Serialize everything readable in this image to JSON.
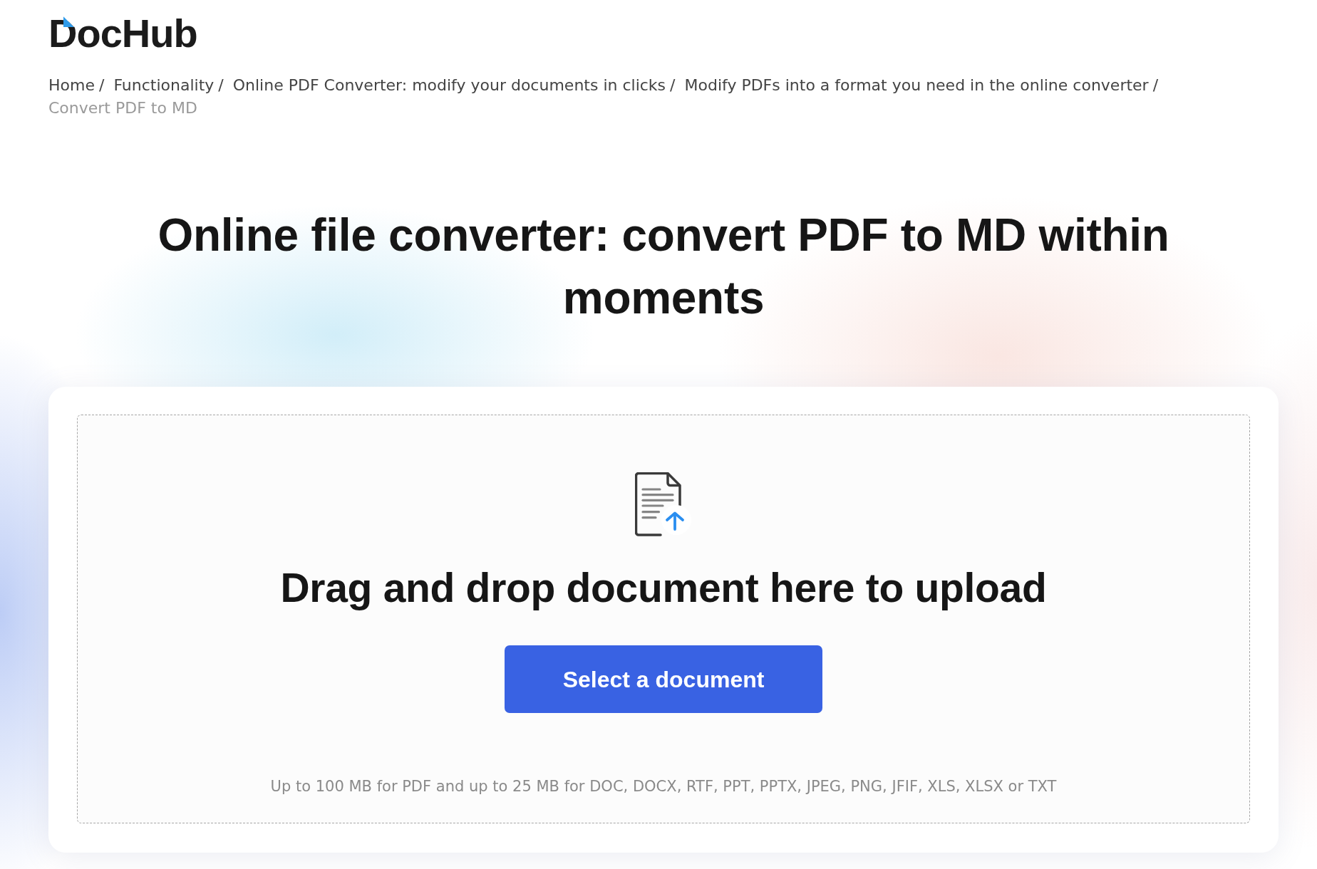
{
  "logo": {
    "text": "DocHub"
  },
  "breadcrumb": [
    {
      "label": "Home",
      "current": false,
      "separator": "/"
    },
    {
      "label": "Functionality",
      "current": false,
      "separator": "/"
    },
    {
      "label": "Online PDF Converter: modify your documents in clicks",
      "current": false,
      "separator": "/"
    },
    {
      "label": "Modify PDFs into a format you need in the online converter",
      "current": false,
      "separator": "/"
    },
    {
      "label": "Convert PDF to MD",
      "current": true
    }
  ],
  "heading": "Online file converter: convert PDF to MD within moments",
  "upload": {
    "title": "Drag and drop document here to upload",
    "button": "Select a document",
    "note": "Up to 100 MB for PDF and up to 25 MB for DOC, DOCX, RTF, PPT, PPTX, JPEG, PNG, JFIF, XLS, XLSX or TXT"
  }
}
